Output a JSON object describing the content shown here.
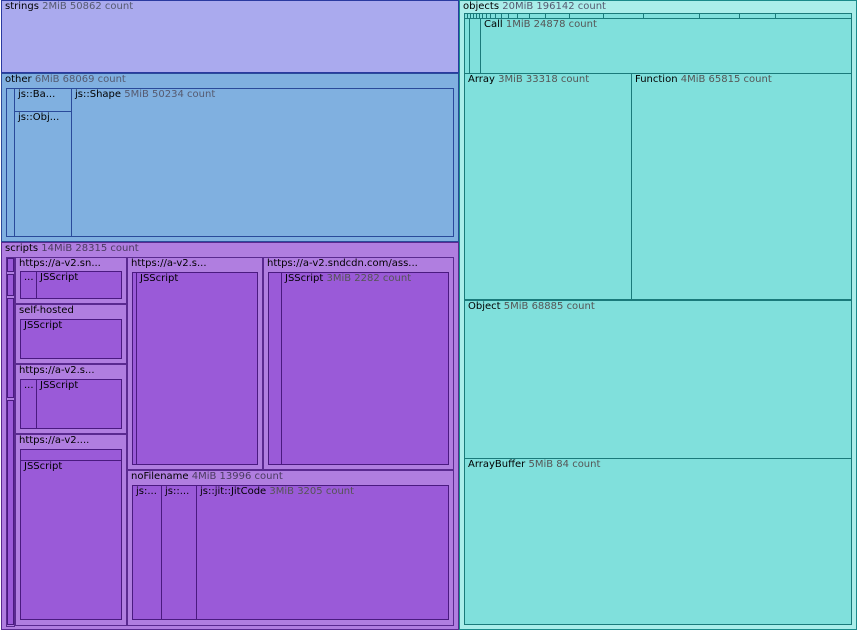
{
  "strings": {
    "name": "strings",
    "meta": "2MiB 50862 count"
  },
  "other": {
    "name": "other",
    "meta": "6MiB 68069 count",
    "ba": {
      "name": "js::Ba..."
    },
    "obj": {
      "name": "js::Obj..."
    },
    "shape": {
      "name": "js::Shape",
      "meta": "5MiB 50234 count"
    }
  },
  "scripts": {
    "name": "scripts",
    "meta": "14MiB 28315 count",
    "s1": {
      "name": "https://a-v2.sn...",
      "dots": "...",
      "jsscript": "JSScript"
    },
    "self": {
      "name": "self-hosted",
      "jsscript": "JSScript"
    },
    "s3": {
      "name": "https://a-v2.s...",
      "dots": "...",
      "jsscript": "JSScript"
    },
    "s4": {
      "name": "https://a-v2....",
      "jsscript": "JSScript"
    },
    "mid": {
      "name": "https://a-v2.s...",
      "jsscript": "JSScript"
    },
    "big": {
      "name": "https://a-v2.sndcdn.com/ass...",
      "jsscript": "JSScript",
      "meta": "3MiB 2282 count"
    },
    "nofile": {
      "name": "noFilename",
      "meta": "4MiB 13996 count",
      "js1": "js:...",
      "js2": "js::...",
      "jit": {
        "name": "js::jit::JitCode",
        "meta": "3MiB 3205 count"
      }
    }
  },
  "objects": {
    "name": "objects",
    "meta": "20MiB 196142 count",
    "call": {
      "name": "Call",
      "meta": "1MiB 24878 count"
    },
    "array": {
      "name": "Array",
      "meta": "3MiB 33318 count"
    },
    "function": {
      "name": "Function",
      "meta": "4MiB 65815 count"
    },
    "object": {
      "name": "Object",
      "meta": "5MiB 68885 count"
    },
    "arraybuffer": {
      "name": "ArrayBuffer",
      "meta": "5MiB 84 count"
    }
  }
}
